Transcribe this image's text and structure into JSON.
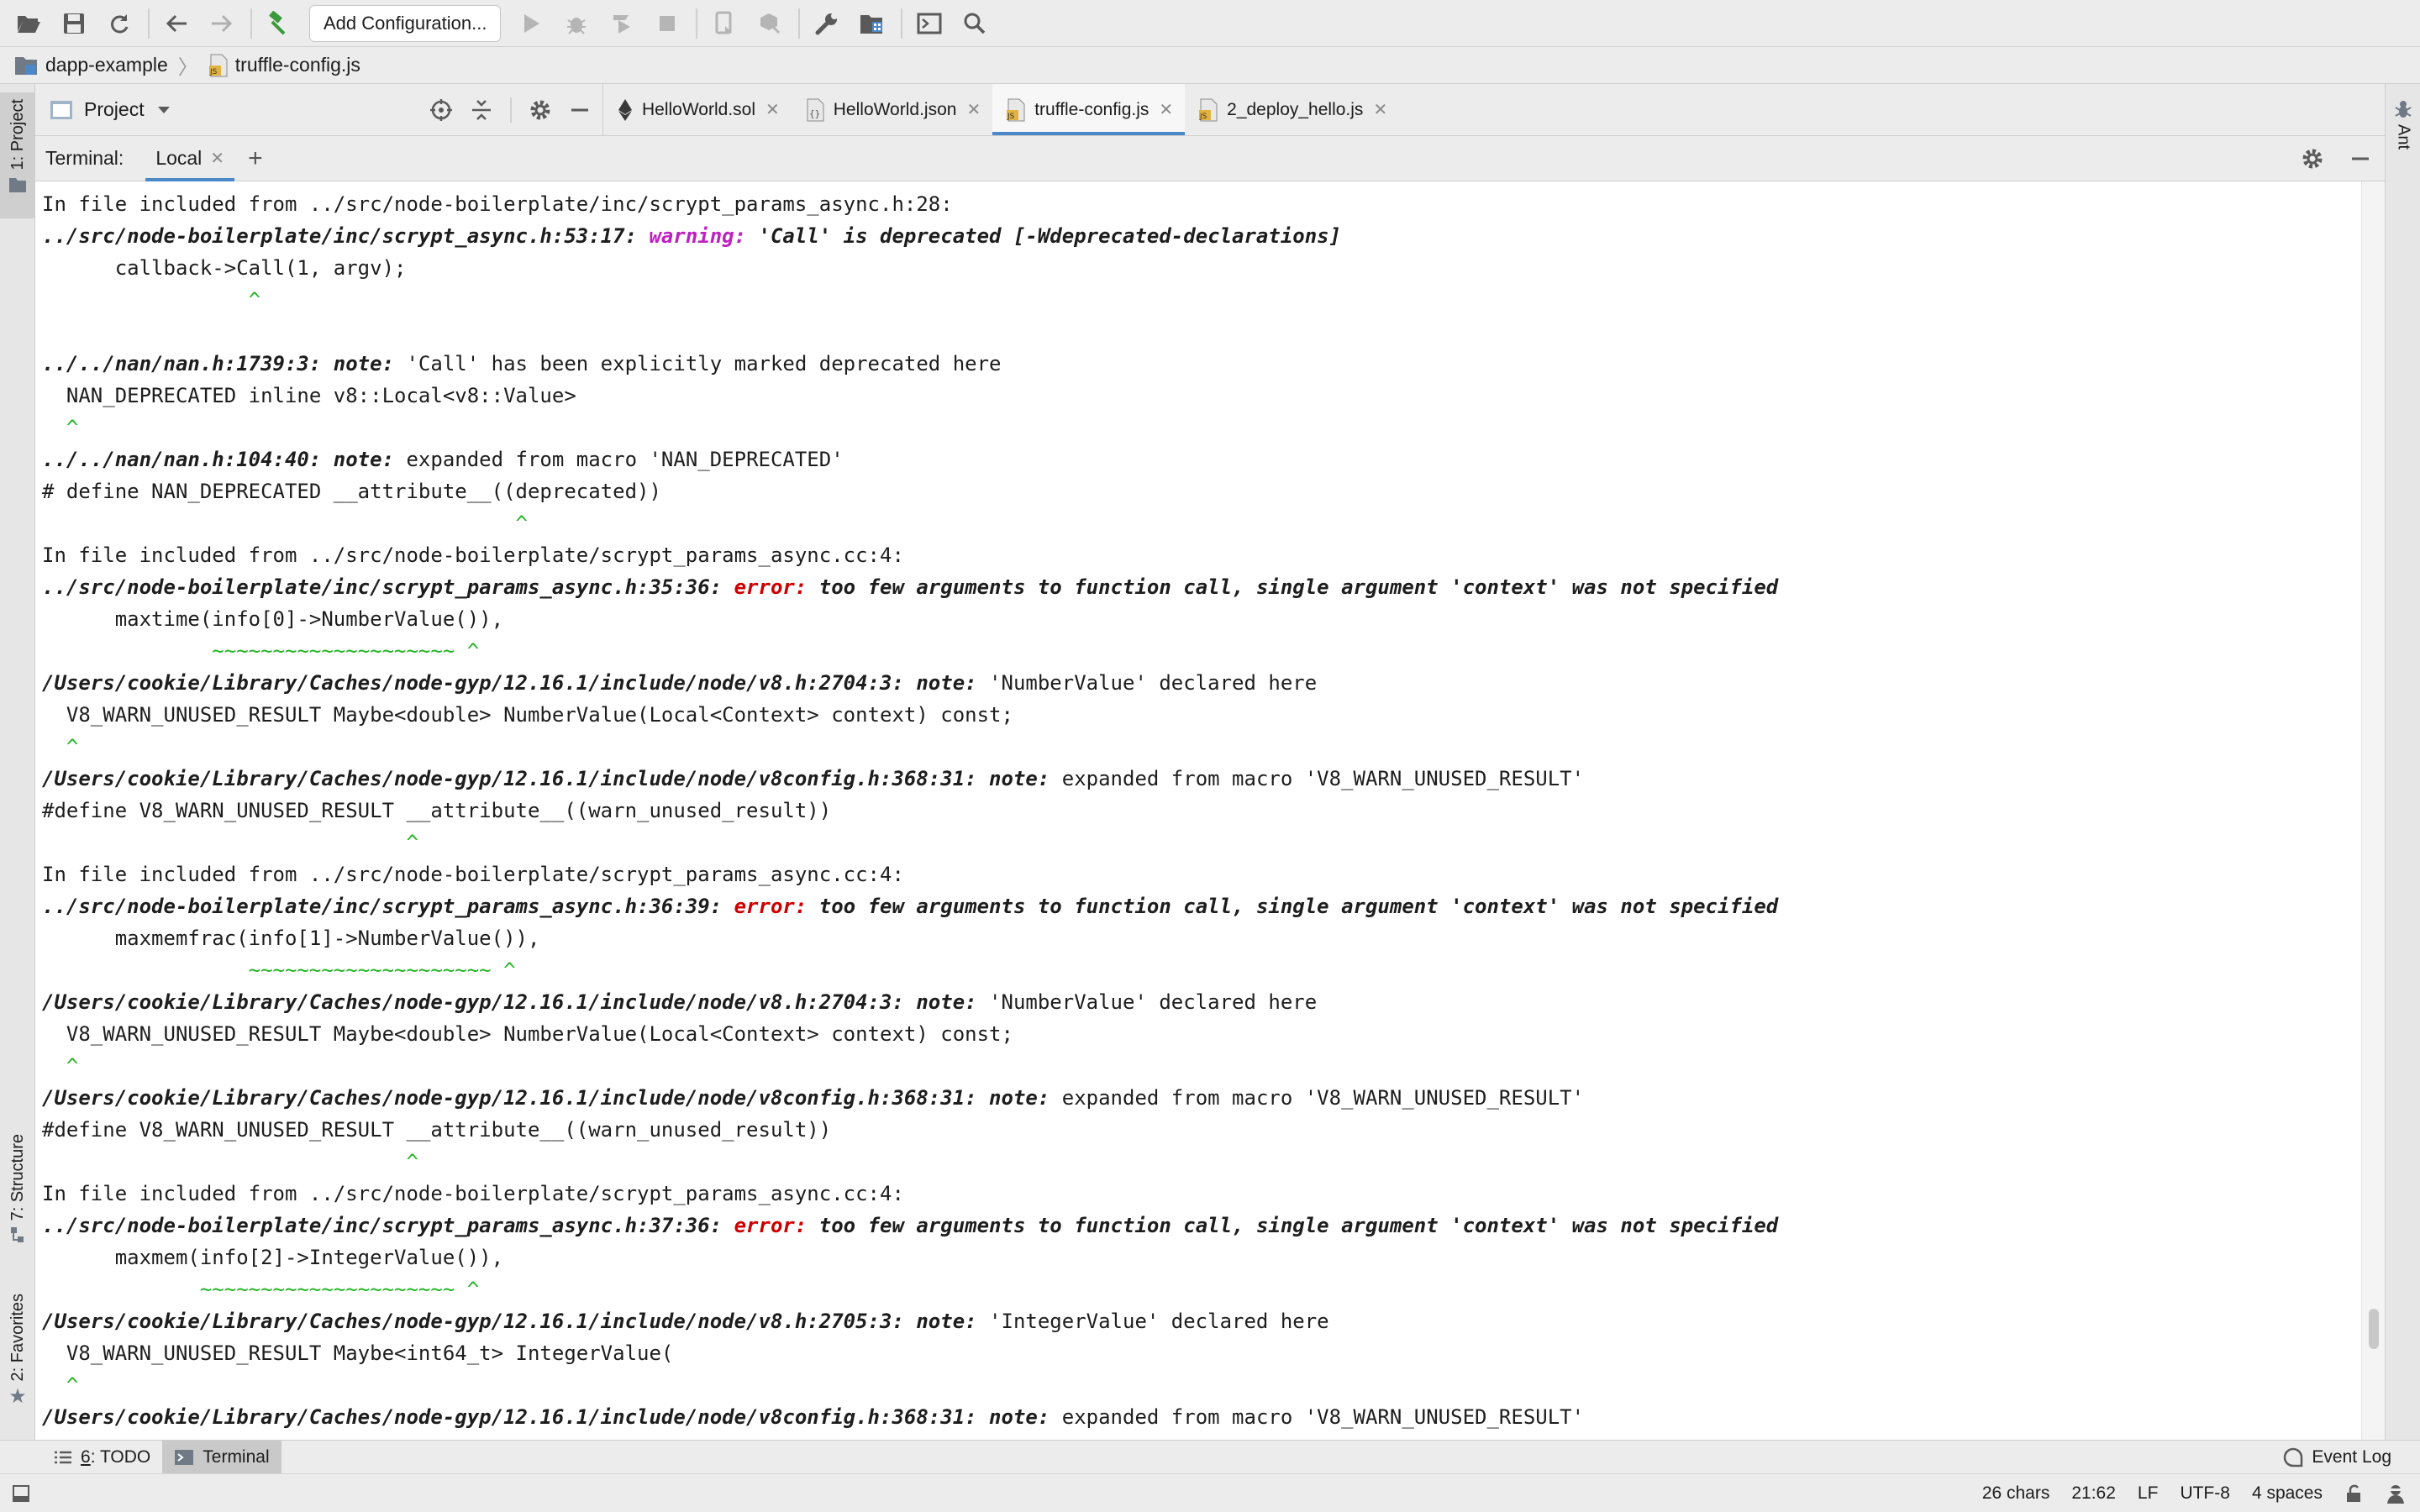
{
  "toolbar": {
    "add_configuration": "Add Configuration...",
    "icons": [
      "folder-open-icon",
      "save-icon",
      "sync-icon",
      "back-icon",
      "forward-icon",
      "build-hammer-icon",
      "run-icon",
      "debug-icon",
      "coverage-icon",
      "stop-icon",
      "device-icon",
      "deploy-icon",
      "wrench-icon",
      "project-structure-icon",
      "terminal-icon",
      "search-icon"
    ]
  },
  "breadcrumb": {
    "project": "dapp-example",
    "file": "truffle-config.js"
  },
  "left_stripe": {
    "project": "1: Project",
    "structure": "7: Structure",
    "favorites": "2: Favorites"
  },
  "right_stripe": {
    "ant": "Ant"
  },
  "project_panel": {
    "title": "Project"
  },
  "editor_tabs": [
    {
      "label": "HelloWorld.sol",
      "icon": "ethereum-icon",
      "active": false
    },
    {
      "label": "HelloWorld.json",
      "icon": "json-icon",
      "active": false
    },
    {
      "label": "truffle-config.js",
      "icon": "js-file-icon",
      "active": true
    },
    {
      "label": "2_deploy_hello.js",
      "icon": "js-file-icon",
      "active": false
    }
  ],
  "terminal": {
    "title": "Terminal:",
    "tab": "Local",
    "lines": [
      [
        {
          "t": "In file included from ../src/node-boilerplate/inc/scrypt_params_async.h:28:",
          "c": ""
        }
      ],
      [
        {
          "t": "../src/node-boilerplate/inc/scrypt_async.h:53:17: ",
          "c": "path"
        },
        {
          "t": "warning: ",
          "c": "kw-warning"
        },
        {
          "t": "'Call' is deprecated [-Wdeprecated-declarations]",
          "c": "msg-b"
        }
      ],
      [
        {
          "t": "      callback->Call(1, argv);",
          "c": ""
        }
      ],
      [
        {
          "t": "                 ^",
          "c": "green"
        }
      ],
      [
        {
          "t": "",
          "c": ""
        }
      ],
      [
        {
          "t": "../../nan/nan.h:1739:3: ",
          "c": "path"
        },
        {
          "t": "note: ",
          "c": "kw-note"
        },
        {
          "t": "'Call' has been explicitly marked deprecated here",
          "c": ""
        }
      ],
      [
        {
          "t": "  NAN_DEPRECATED inline v8::Local<v8::Value>",
          "c": ""
        }
      ],
      [
        {
          "t": "  ^",
          "c": "green"
        }
      ],
      [
        {
          "t": "../../nan/nan.h:104:40: ",
          "c": "path"
        },
        {
          "t": "note: ",
          "c": "kw-note"
        },
        {
          "t": "expanded from macro 'NAN_DEPRECATED'",
          "c": ""
        }
      ],
      [
        {
          "t": "# define NAN_DEPRECATED __attribute__((deprecated))",
          "c": ""
        }
      ],
      [
        {
          "t": "                                       ^",
          "c": "green"
        }
      ],
      [
        {
          "t": "In file included from ../src/node-boilerplate/scrypt_params_async.cc:4:",
          "c": ""
        }
      ],
      [
        {
          "t": "../src/node-boilerplate/inc/scrypt_params_async.h:35:36: ",
          "c": "path"
        },
        {
          "t": "error: ",
          "c": "kw-error"
        },
        {
          "t": "too few arguments to function call, single argument 'context' was not specified",
          "c": "msg-b"
        }
      ],
      [
        {
          "t": "      maxtime(info[0]->NumberValue()),",
          "c": ""
        }
      ],
      [
        {
          "t": "              ~~~~~~~~~~~~~~~~~~~~ ^",
          "c": "green"
        }
      ],
      [
        {
          "t": "/Users/cookie/Library/Caches/node-gyp/12.16.1/include/node/v8.h:2704:3: ",
          "c": "path"
        },
        {
          "t": "note: ",
          "c": "kw-note"
        },
        {
          "t": "'NumberValue' declared here",
          "c": ""
        }
      ],
      [
        {
          "t": "  V8_WARN_UNUSED_RESULT Maybe<double> NumberValue(Local<Context> context) const;",
          "c": ""
        }
      ],
      [
        {
          "t": "  ^",
          "c": "green"
        }
      ],
      [
        {
          "t": "/Users/cookie/Library/Caches/node-gyp/12.16.1/include/node/v8config.h:368:31: ",
          "c": "path"
        },
        {
          "t": "note: ",
          "c": "kw-note"
        },
        {
          "t": "expanded from macro 'V8_WARN_UNUSED_RESULT'",
          "c": ""
        }
      ],
      [
        {
          "t": "#define V8_WARN_UNUSED_RESULT __attribute__((warn_unused_result))",
          "c": ""
        }
      ],
      [
        {
          "t": "                              ^",
          "c": "green"
        }
      ],
      [
        {
          "t": "In file included from ../src/node-boilerplate/scrypt_params_async.cc:4:",
          "c": ""
        }
      ],
      [
        {
          "t": "../src/node-boilerplate/inc/scrypt_params_async.h:36:39: ",
          "c": "path"
        },
        {
          "t": "error: ",
          "c": "kw-error"
        },
        {
          "t": "too few arguments to function call, single argument 'context' was not specified",
          "c": "msg-b"
        }
      ],
      [
        {
          "t": "      maxmemfrac(info[1]->NumberValue()),",
          "c": ""
        }
      ],
      [
        {
          "t": "                 ~~~~~~~~~~~~~~~~~~~~ ^",
          "c": "green"
        }
      ],
      [
        {
          "t": "/Users/cookie/Library/Caches/node-gyp/12.16.1/include/node/v8.h:2704:3: ",
          "c": "path"
        },
        {
          "t": "note: ",
          "c": "kw-note"
        },
        {
          "t": "'NumberValue' declared here",
          "c": ""
        }
      ],
      [
        {
          "t": "  V8_WARN_UNUSED_RESULT Maybe<double> NumberValue(Local<Context> context) const;",
          "c": ""
        }
      ],
      [
        {
          "t": "  ^",
          "c": "green"
        }
      ],
      [
        {
          "t": "/Users/cookie/Library/Caches/node-gyp/12.16.1/include/node/v8config.h:368:31: ",
          "c": "path"
        },
        {
          "t": "note: ",
          "c": "kw-note"
        },
        {
          "t": "expanded from macro 'V8_WARN_UNUSED_RESULT'",
          "c": ""
        }
      ],
      [
        {
          "t": "#define V8_WARN_UNUSED_RESULT __attribute__((warn_unused_result))",
          "c": ""
        }
      ],
      [
        {
          "t": "                              ^",
          "c": "green"
        }
      ],
      [
        {
          "t": "In file included from ../src/node-boilerplate/scrypt_params_async.cc:4:",
          "c": ""
        }
      ],
      [
        {
          "t": "../src/node-boilerplate/inc/scrypt_params_async.h:37:36: ",
          "c": "path"
        },
        {
          "t": "error: ",
          "c": "kw-error"
        },
        {
          "t": "too few arguments to function call, single argument 'context' was not specified",
          "c": "msg-b"
        }
      ],
      [
        {
          "t": "      maxmem(info[2]->IntegerValue()),",
          "c": ""
        }
      ],
      [
        {
          "t": "             ~~~~~~~~~~~~~~~~~~~~~ ^",
          "c": "green"
        }
      ],
      [
        {
          "t": "/Users/cookie/Library/Caches/node-gyp/12.16.1/include/node/v8.h:2705:3: ",
          "c": "path"
        },
        {
          "t": "note: ",
          "c": "kw-note"
        },
        {
          "t": "'IntegerValue' declared here",
          "c": ""
        }
      ],
      [
        {
          "t": "  V8_WARN_UNUSED_RESULT Maybe<int64_t> IntegerValue(",
          "c": ""
        }
      ],
      [
        {
          "t": "  ^",
          "c": "green"
        }
      ],
      [
        {
          "t": "/Users/cookie/Library/Caches/node-gyp/12.16.1/include/node/v8config.h:368:31: ",
          "c": "path"
        },
        {
          "t": "note: ",
          "c": "kw-note"
        },
        {
          "t": "expanded from macro 'V8_WARN_UNUSED_RESULT'",
          "c": ""
        }
      ],
      [
        {
          "t": "#define V8_WARN_UNUSED_RESULT __attribute__((warn_unused_result))",
          "c": ""
        }
      ]
    ]
  },
  "bottom_tools": {
    "todo_key": "6",
    "todo_label": ": TODO",
    "terminal": "Terminal",
    "event_log": "Event Log"
  },
  "status": {
    "chars": "26 chars",
    "position": "21:62",
    "line_sep": "LF",
    "encoding": "UTF-8",
    "indent": "4 spaces"
  },
  "colors": {
    "accent": "#4a88c7",
    "warning": "#c020c0",
    "error": "#cc0000",
    "caret": "#22b522"
  }
}
